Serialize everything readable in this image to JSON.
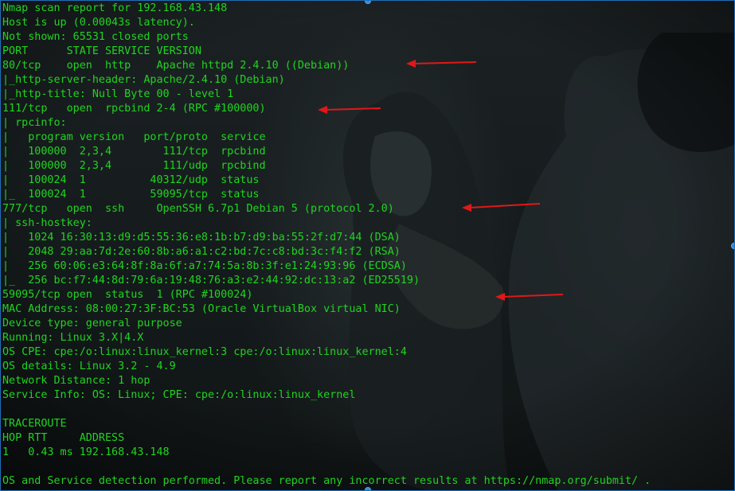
{
  "terminal": {
    "lines": [
      "Nmap scan report for 192.168.43.148",
      "Host is up (0.00043s latency).",
      "Not shown: 65531 closed ports",
      "PORT      STATE SERVICE VERSION",
      "80/tcp    open  http    Apache httpd 2.4.10 ((Debian))",
      "|_http-server-header: Apache/2.4.10 (Debian)",
      "|_http-title: Null Byte 00 - level 1",
      "111/tcp   open  rpcbind 2-4 (RPC #100000)",
      "| rpcinfo:",
      "|   program version   port/proto  service",
      "|   100000  2,3,4        111/tcp  rpcbind",
      "|   100000  2,3,4        111/udp  rpcbind",
      "|   100024  1          40312/udp  status",
      "|_  100024  1          59095/tcp  status",
      "777/tcp   open  ssh     OpenSSH 6.7p1 Debian 5 (protocol 2.0)",
      "| ssh-hostkey:",
      "|   1024 16:30:13:d9:d5:55:36:e8:1b:b7:d9:ba:55:2f:d7:44 (DSA)",
      "|   2048 29:aa:7d:2e:60:8b:a6:a1:c2:bd:7c:c8:bd:3c:f4:f2 (RSA)",
      "|   256 60:06:e3:64:8f:8a:6f:a7:74:5a:8b:3f:e1:24:93:96 (ECDSA)",
      "|_  256 bc:f7:44:8d:79:6a:19:48:76:a3:e2:44:92:dc:13:a2 (ED25519)",
      "59095/tcp open  status  1 (RPC #100024)",
      "MAC Address: 08:00:27:3F:BC:53 (Oracle VirtualBox virtual NIC)",
      "Device type: general purpose",
      "Running: Linux 3.X|4.X",
      "OS CPE: cpe:/o:linux:linux_kernel:3 cpe:/o:linux:linux_kernel:4",
      "OS details: Linux 3.2 - 4.9",
      "Network Distance: 1 hop",
      "Service Info: OS: Linux; CPE: cpe:/o:linux:linux_kernel",
      "",
      "TRACEROUTE",
      "HOP RTT     ADDRESS",
      "1   0.43 ms 192.168.43.148",
      "",
      "OS and Service detection performed. Please report any incorrect results at https://nmap.org/submit/ ."
    ]
  },
  "colors": {
    "terminal_text": "#1fd51f",
    "annotation_arrow": "#e01818",
    "selection_handle": "#2a8be0"
  },
  "annotations": {
    "arrow_icon": "red-arrow-icon",
    "highlighted_lines": [
      "80/tcp",
      "111/tcp",
      "777/tcp",
      "59095/tcp"
    ]
  }
}
